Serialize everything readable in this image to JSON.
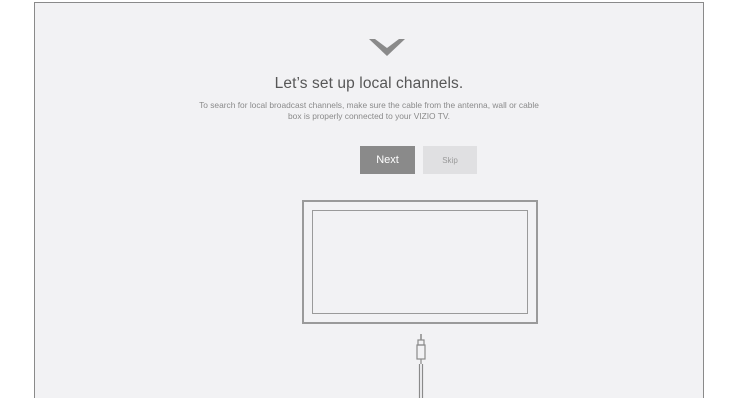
{
  "setup": {
    "title": "Let’s set up local channels.",
    "description": "To search for local broadcast channels, make sure the cable from the antenna, wall or cable box is properly connected to your VIZIO TV.",
    "next_label": "Next",
    "skip_label": "Skip"
  },
  "icons": {
    "logo": "vizio-v-logo-icon",
    "tv": "tv-illustration-icon",
    "cable": "coaxial-cable-icon"
  },
  "colors": {
    "background": "#f2f2f4",
    "primary_button": "#8a8a8a",
    "secondary_button": "#e0e0e2",
    "title_text": "#575757"
  }
}
